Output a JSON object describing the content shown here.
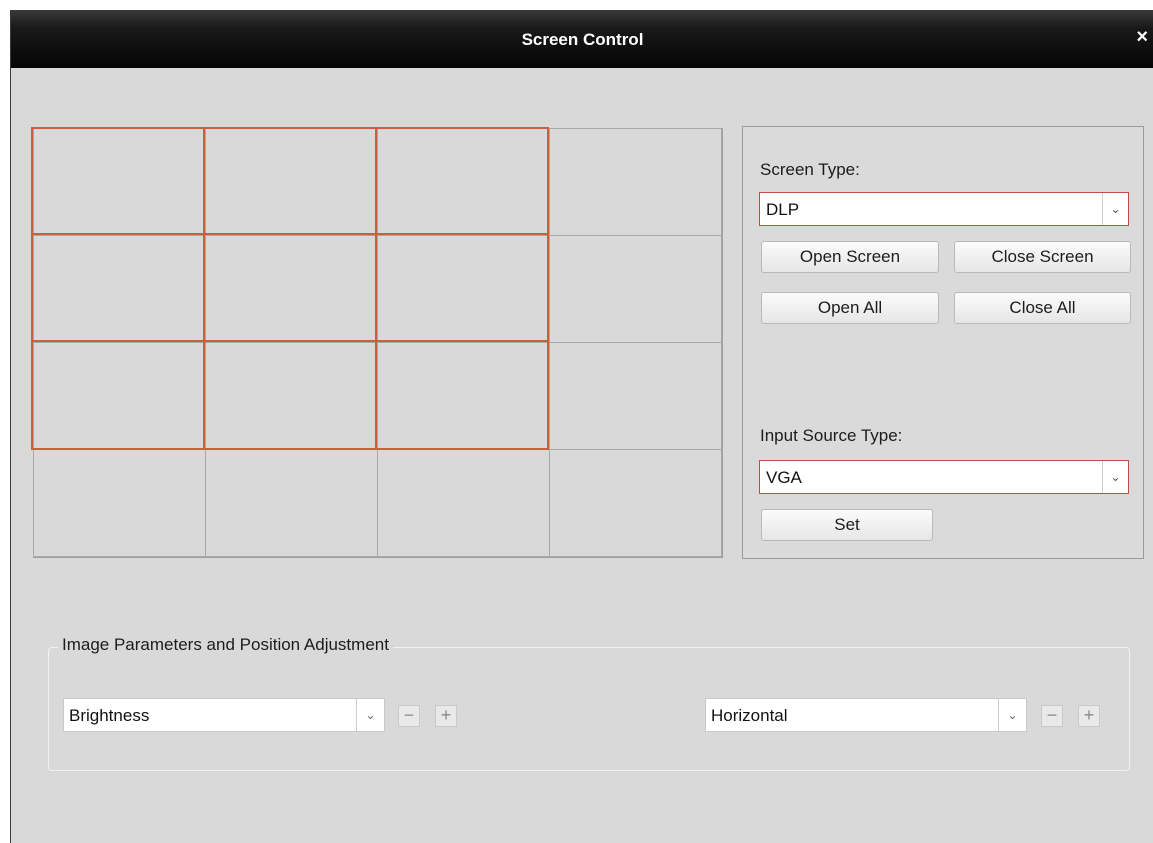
{
  "window": {
    "title": "Screen Control",
    "close_glyph": "×"
  },
  "screen_grid": {
    "rows": 4,
    "cols": 4,
    "selected_rows": 3,
    "selected_cols": 3,
    "selection_color": "#c8603a"
  },
  "panel": {
    "screen_type_label": "Screen Type:",
    "screen_type_value": "DLP",
    "open_screen": "Open Screen",
    "close_screen": "Close Screen",
    "open_all": "Open All",
    "close_all": "Close All",
    "input_source_label": "Input Source Type:",
    "input_source_value": "VGA",
    "set": "Set"
  },
  "adjust": {
    "legend": "Image Parameters and Position Adjustment",
    "param_value": "Brightness",
    "position_value": "Horizontal",
    "minus": "−",
    "plus": "+"
  },
  "icons": {
    "dropdown": "chevron-down-icon",
    "close": "close-icon"
  }
}
